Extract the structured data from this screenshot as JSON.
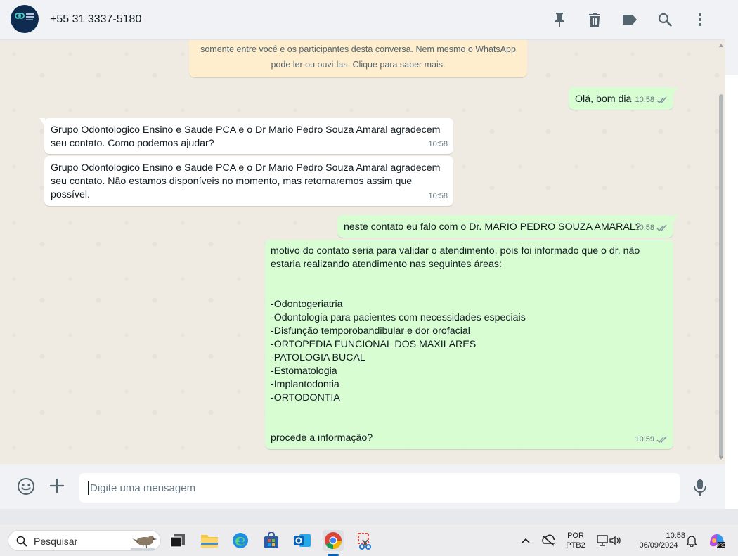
{
  "header": {
    "contact_name": "+55 31 3337-5180",
    "icons": [
      "pin-icon",
      "delete-icon",
      "label-icon",
      "search-icon",
      "menu-icon"
    ]
  },
  "encryption_notice": {
    "line2": "somente entre você e os participantes desta conversa. Nem mesmo o WhatsApp",
    "line3": "pode ler ou ouvi-las. Clique para saber mais."
  },
  "messages": [
    {
      "direction": "out",
      "text": "Olá, bom dia",
      "time": "10:58",
      "status": "double-check-icon"
    },
    {
      "direction": "in",
      "text": "Grupo Odontologico Ensino e Saude PCA e o Dr Mario Pedro Souza Amaral agradecem\nseu contato. Como podemos ajudar?",
      "time": "10:58"
    },
    {
      "direction": "in",
      "text": "Grupo Odontologico Ensino e Saude PCA e o Dr Mario Pedro Souza Amaral agradecem\nseu contato. Não estamos disponíveis no momento, mas retornaremos assim que possível.",
      "time": "10:58"
    },
    {
      "direction": "out",
      "text": "neste contato eu falo com o Dr. MARIO PEDRO SOUZA AMARAL?",
      "time": "10:58",
      "status": "double-check-icon"
    },
    {
      "direction": "out",
      "text": "motivo do contato seria para validar o atendimento, pois foi informado que o dr. não\nestaria realizando atendimento nas seguintes áreas:\n\n\n-Odontogeriatria\n-Odontologia para pacientes com necessidades especiais\n-Disfunção temporobandibular e dor orofacial\n-ORTOPEDIA FUNCIONAL DOS MAXILARES\n-PATOLOGIA BUCAL\n-Estomatologia\n-Implantodontia\n-ORTODONTIA\n\n\nprocede a informação?",
      "time": "10:59",
      "status": "double-check-icon"
    }
  ],
  "composer": {
    "placeholder": "Digite uma mensagem"
  },
  "taskbar": {
    "search_placeholder": "Pesquisar",
    "language_line1": "POR",
    "language_line2": "PTB2",
    "time": "10:58",
    "date": "06/09/2024"
  },
  "colors": {
    "outgoing_bubble": "#d9fdd3",
    "incoming_bubble": "#ffffff",
    "chat_background": "#efeae2",
    "notice_background": "#ffeecd",
    "read_tick": "#53bdeb"
  }
}
